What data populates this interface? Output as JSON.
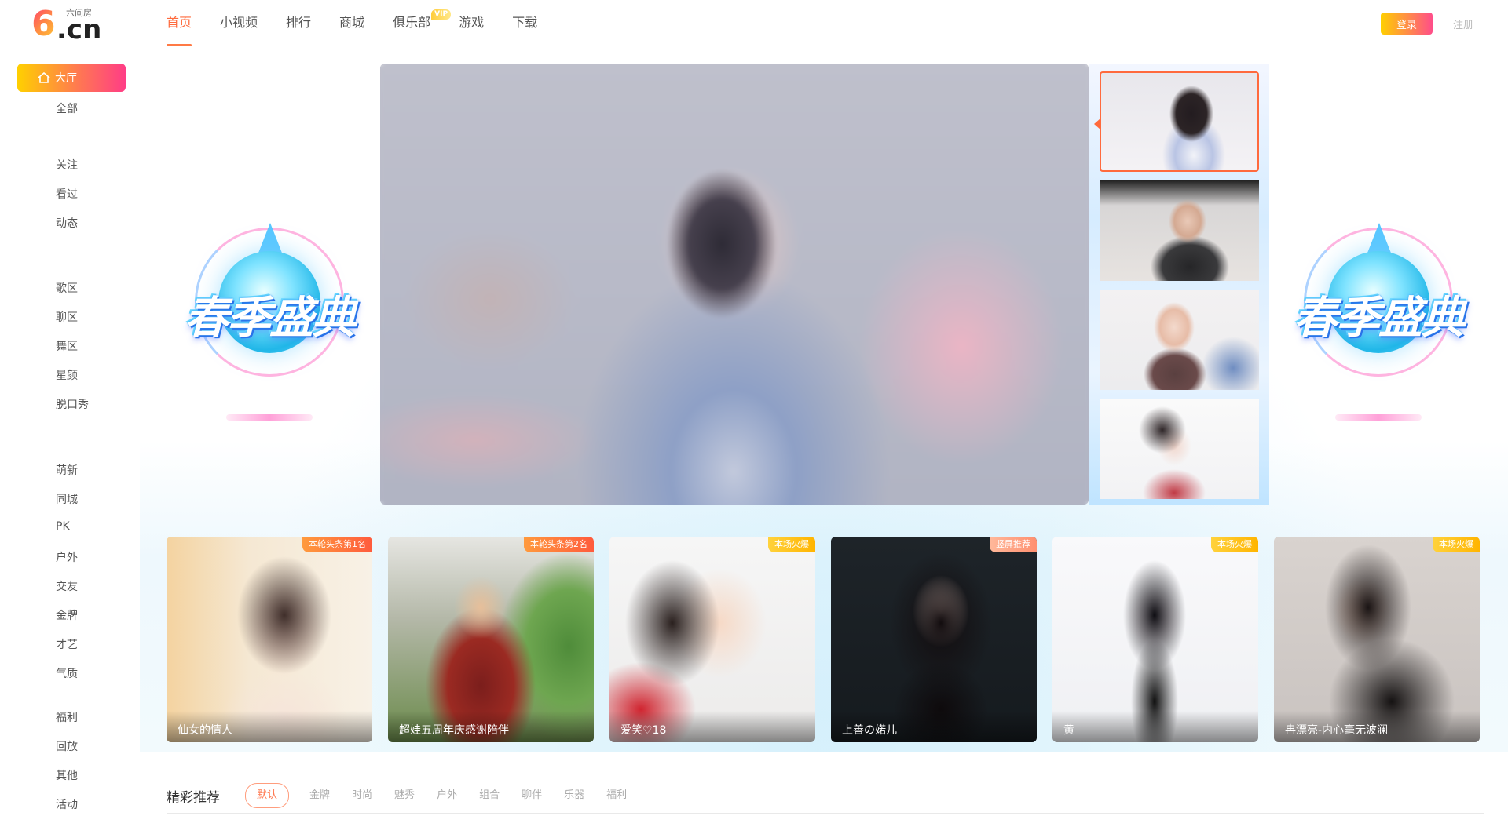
{
  "logo": {
    "mark": "6",
    "domain": ".cn",
    "subtitle": "六间房"
  },
  "sidebar": {
    "hall": "大厅",
    "items": [
      "全部",
      "关注",
      "看过",
      "动态",
      "歌区",
      "聊区",
      "舞区",
      "星颜",
      "脱口秀",
      "萌新",
      "同城",
      "PK",
      "户外",
      "交友",
      "金牌",
      "才艺",
      "气质",
      "福利",
      "回放",
      "其他",
      "活动"
    ]
  },
  "topnav": {
    "tabs": [
      "首页",
      "小视频",
      "排行",
      "商城",
      "俱乐部",
      "游戏",
      "下载"
    ],
    "active": "首页",
    "vip_badge": "VIP"
  },
  "auth": {
    "login": "登录",
    "register": "注册"
  },
  "banner": {
    "title": "春季盛典"
  },
  "cards": [
    {
      "tag": "本轮头条第1名",
      "name": "仙女的情人"
    },
    {
      "tag": "本轮头条第2名",
      "name": "超娃五周年庆感谢陪伴"
    },
    {
      "tag": "本场火爆",
      "name": "爱笑♡18"
    },
    {
      "tag": "竖屏推荐",
      "name": "上善の婼儿"
    },
    {
      "tag": "本场火爆",
      "name": "黄"
    },
    {
      "tag": "本场火爆",
      "name": "冉漂亮-内心毫无波澜"
    }
  ],
  "recommend": {
    "title": "精彩推荐",
    "tabs": [
      "默认",
      "金牌",
      "时尚",
      "魅秀",
      "户外",
      "组合",
      "聊伴",
      "乐器",
      "福利"
    ]
  },
  "colors": {
    "accent": "#ff6b3d",
    "gradient_start": "#ffd000",
    "gradient_end": "#ff3d86"
  }
}
